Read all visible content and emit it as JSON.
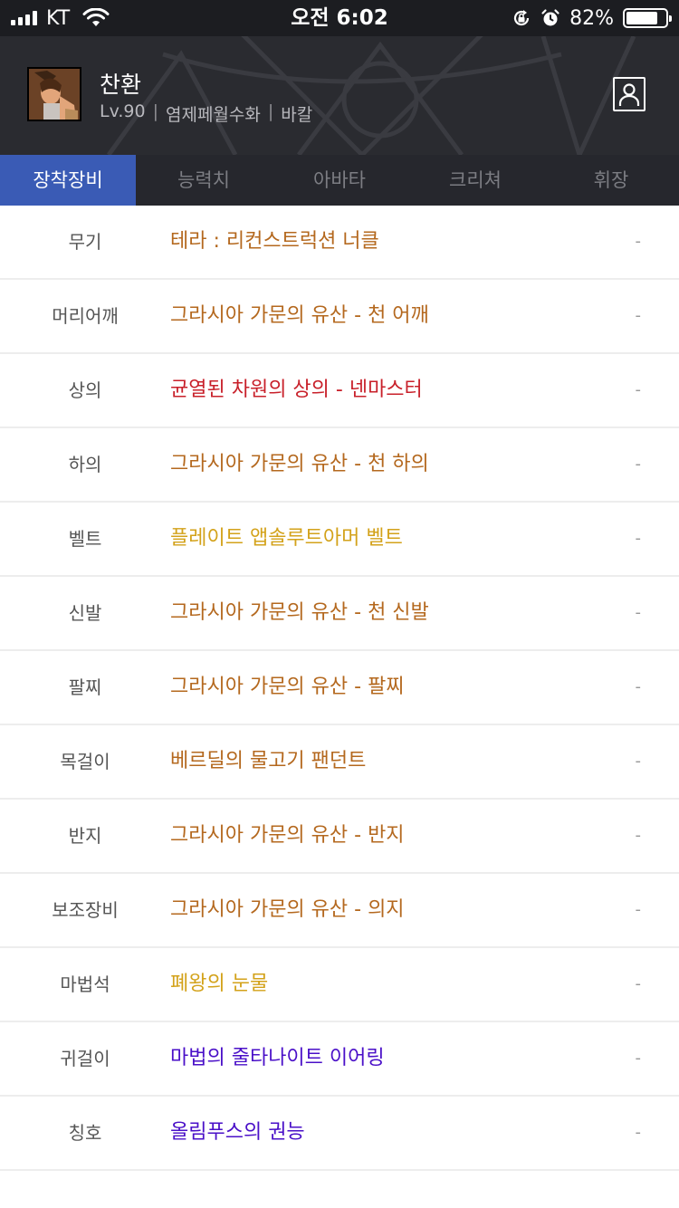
{
  "status_bar": {
    "carrier": "KT",
    "time": "오전 6:02",
    "battery_percent": "82%",
    "battery_level": 0.82
  },
  "character": {
    "name": "찬환",
    "level": "Lv.90",
    "job": "염제페월수화",
    "server": "바칼",
    "separator": "|"
  },
  "tabs": [
    {
      "label": "장착장비",
      "active": true
    },
    {
      "label": "능력치",
      "active": false
    },
    {
      "label": "아바타",
      "active": false
    },
    {
      "label": "크리쳐",
      "active": false
    },
    {
      "label": "휘장",
      "active": false
    }
  ],
  "colors": {
    "unique": "#b4681e",
    "epic_red": "#c8202a",
    "legendary_gold": "#d3a21a",
    "rare_purple": "#4a10c8",
    "active_tab": "#3a5bb5"
  },
  "equipment": [
    {
      "slot": "무기",
      "item": "테라 : 리컨스트럭션 너클",
      "color": "#b4681e",
      "value": "-"
    },
    {
      "slot": "머리어깨",
      "item": "그라시아 가문의 유산 - 천 어깨",
      "color": "#b4681e",
      "value": "-"
    },
    {
      "slot": "상의",
      "item": "균열된 차원의 상의 - 넨마스터",
      "color": "#c8202a",
      "value": "-"
    },
    {
      "slot": "하의",
      "item": "그라시아 가문의 유산 - 천 하의",
      "color": "#b4681e",
      "value": "-"
    },
    {
      "slot": "벨트",
      "item": "플레이트 앱솔루트아머 벨트",
      "color": "#d3a21a",
      "value": "-"
    },
    {
      "slot": "신발",
      "item": "그라시아 가문의 유산 - 천 신발",
      "color": "#b4681e",
      "value": "-"
    },
    {
      "slot": "팔찌",
      "item": "그라시아 가문의 유산 - 팔찌",
      "color": "#b4681e",
      "value": "-"
    },
    {
      "slot": "목걸이",
      "item": "베르딜의 물고기 팬던트",
      "color": "#b4681e",
      "value": "-"
    },
    {
      "slot": "반지",
      "item": "그라시아 가문의 유산 - 반지",
      "color": "#b4681e",
      "value": "-"
    },
    {
      "slot": "보조장비",
      "item": "그라시아 가문의 유산 - 의지",
      "color": "#b4681e",
      "value": "-"
    },
    {
      "slot": "마법석",
      "item": "폐왕의 눈물",
      "color": "#d3a21a",
      "value": "-"
    },
    {
      "slot": "귀걸이",
      "item": "마법의 줄타나이트 이어링",
      "color": "#4a10c8",
      "value": "-"
    },
    {
      "slot": "칭호",
      "item": "올림푸스의 권능",
      "color": "#4a10c8",
      "value": "-"
    }
  ]
}
